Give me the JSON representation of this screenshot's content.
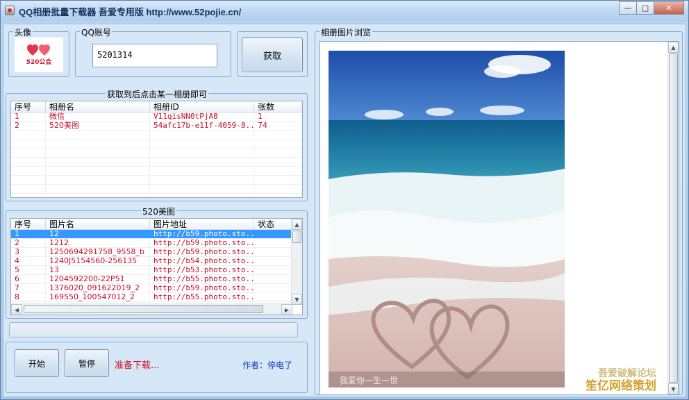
{
  "window": {
    "title": "QQ相册批量下载器  吾爱专用版  http://www.52pojie.cn/",
    "minimize_glyph": "—",
    "maximize_glyph": "□",
    "close_glyph": "✕"
  },
  "avatar": {
    "group_label": "头像",
    "logo_text": "520公会"
  },
  "qq": {
    "group_label": "QQ账号",
    "value": "5201314"
  },
  "fetch_button": "获取",
  "albums": {
    "group_label": "获取到后点击某一相册即可",
    "columns": [
      "序号",
      "相册名",
      "相册ID",
      "张数"
    ],
    "rows": [
      [
        "1",
        "微信",
        "V11qisNN0tPjA8",
        "1"
      ],
      [
        "2",
        "520美图",
        "54afc17b-e11f-4059-8...",
        "74"
      ]
    ]
  },
  "photos": {
    "group_label": "520美图",
    "columns": [
      "序号",
      "图片名",
      "图片地址",
      "状态"
    ],
    "rows": [
      [
        "1",
        "12",
        "http://b59.photo.sto...",
        ""
      ],
      [
        "2",
        "1212",
        "http://b59.photo.sto...",
        ""
      ],
      [
        "3",
        "1250694291758_9558_b",
        "http://b59.photo.sto...",
        ""
      ],
      [
        "4",
        "1240J5154560-256135",
        "http://b54.photo.sto...",
        ""
      ],
      [
        "5",
        "13",
        "http://b53.photo.sto...",
        ""
      ],
      [
        "6",
        "1204592200-22P51",
        "http://b55.photo.sto...",
        ""
      ],
      [
        "7",
        "1376020_091622019_2",
        "http://b59.photo.sto...",
        ""
      ],
      [
        "8",
        "169550_100547012_2",
        "http://b55.photo.sto...",
        ""
      ]
    ],
    "selected_index": 0
  },
  "controls": {
    "start": "开始",
    "pause": "暂停",
    "status": "准备下载...",
    "author": "作者：停电了"
  },
  "preview": {
    "group_label": "相册图片浏览",
    "photo_caption": "我爱你一生一世"
  },
  "watermark": {
    "line1": "吾爱破解论坛",
    "line2": "笙亿网络策划"
  },
  "colors": {
    "status_red": "#d01020",
    "author_blue": "#1030b0",
    "selection": "#3399ff"
  }
}
